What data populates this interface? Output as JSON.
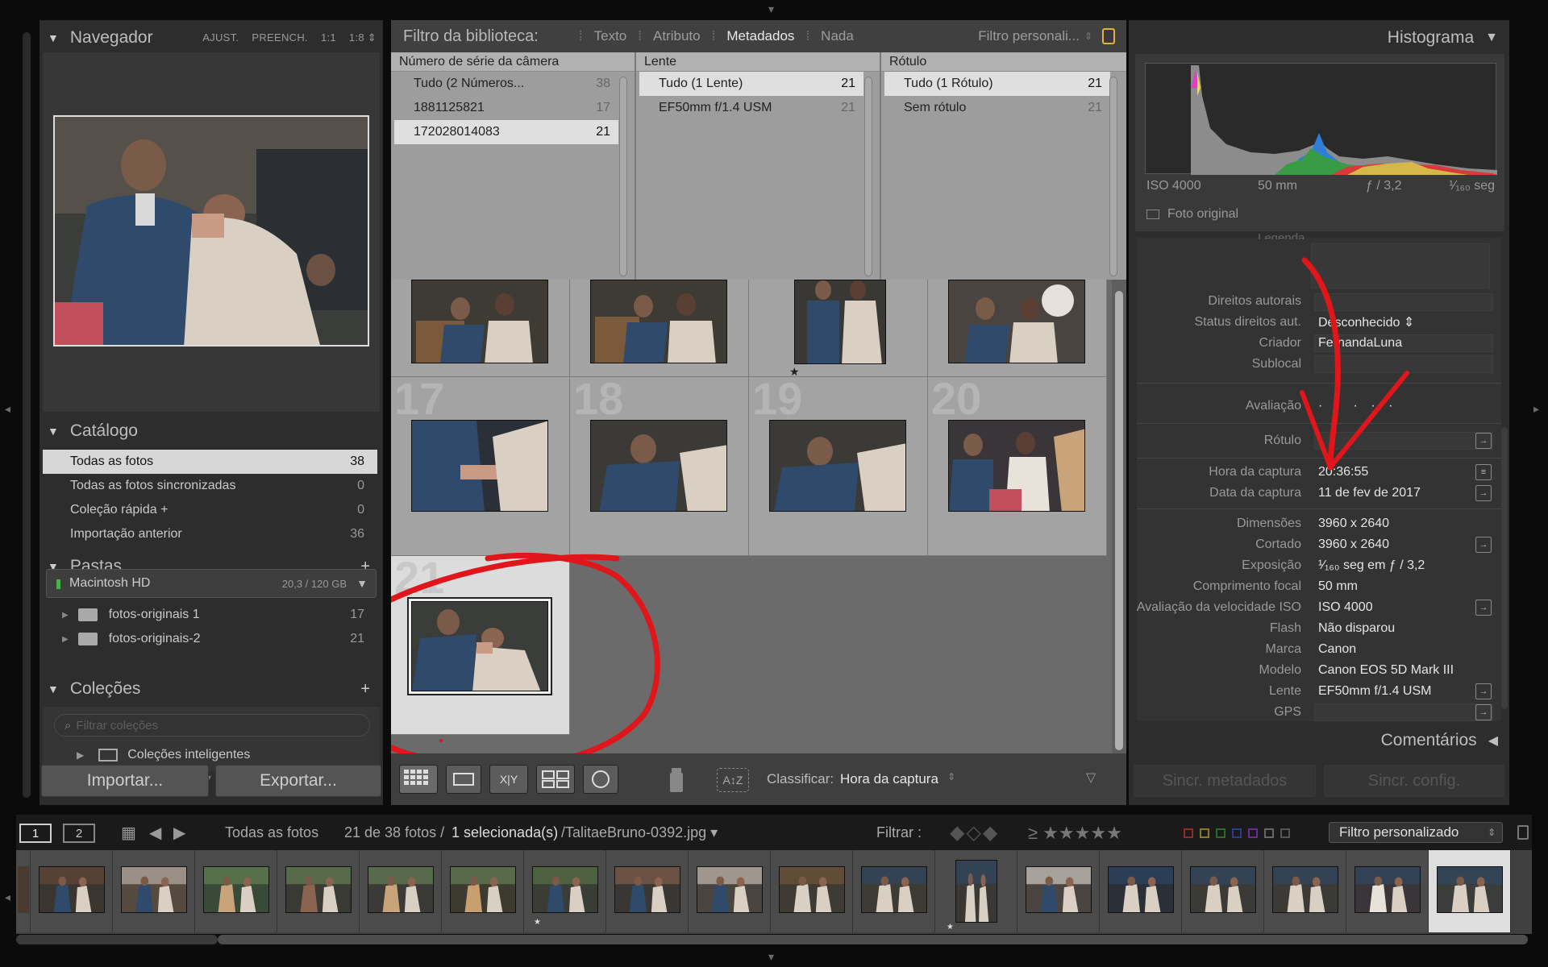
{
  "navigator": {
    "title": "Navegador",
    "opts": [
      "AJUST.",
      "PREENCH.",
      "1:1",
      "1:8 ⇕"
    ]
  },
  "catalog": {
    "title": "Catálogo",
    "items": [
      {
        "label": "Todas as fotos",
        "count": "38"
      },
      {
        "label": "Todas as fotos sincronizadas",
        "count": "0"
      },
      {
        "label": "Coleção rápida +",
        "count": "0"
      },
      {
        "label": "Importação anterior",
        "count": "36"
      }
    ]
  },
  "folders": {
    "title": "Pastas",
    "drive": "Macintosh HD",
    "drive_size": "20,3 / 120 GB",
    "items": [
      {
        "label": "fotos-originais 1",
        "count": "17"
      },
      {
        "label": "fotos-originais-2",
        "count": "21"
      }
    ]
  },
  "collections": {
    "title": "Coleções",
    "filter_placeholder": "Filtrar coleções",
    "smart": "Coleções inteligentes"
  },
  "left_buttons": {
    "import": "Importar...",
    "export": "Exportar..."
  },
  "filter": {
    "title": "Filtro da biblioteca:",
    "tabs": [
      "Texto",
      "Atributo",
      "Metadados",
      "Nada"
    ],
    "active_tab": "Metadados",
    "custom": "Filtro personali...",
    "columns": [
      {
        "header": "Número de série da câmera",
        "rows": [
          {
            "label": "Tudo (2 Números...",
            "count": "38"
          },
          {
            "label": "1881125821",
            "count": "17"
          },
          {
            "label": "172028014083",
            "count": "21",
            "selected": true
          }
        ]
      },
      {
        "header": "Lente",
        "rows": [
          {
            "label": "Tudo (1 Lente)",
            "count": "21",
            "selected": true
          },
          {
            "label": "EF50mm f/1.4 USM",
            "count": "21"
          }
        ]
      },
      {
        "header": "Rótulo",
        "rows": [
          {
            "label": "Tudo (1 Rótulo)",
            "count": "21",
            "selected": true
          },
          {
            "label": "Sem rótulo",
            "count": "21"
          }
        ]
      }
    ]
  },
  "grid": {
    "row2_numbers": [
      "17",
      "18",
      "19",
      "20"
    ],
    "row3_number": "21",
    "star": "★"
  },
  "toolbar": {
    "sort_label": "Classificar:",
    "sort_value": "Hora da captura"
  },
  "histogram": {
    "title": "Histograma",
    "iso": "ISO 4000",
    "focal": "50 mm",
    "aperture": "ƒ / 3,2",
    "shutter": "¹⁄₁₆₀ seg",
    "original": "Foto original"
  },
  "metadata": {
    "caption_label": "Legenda",
    "rows": [
      {
        "label": "Direitos autorais",
        "value": ""
      },
      {
        "label": "Status direitos aut.",
        "value": "Desconhecido ⇕"
      },
      {
        "label": "Criador",
        "value": "FernandaLuna"
      },
      {
        "label": "Sublocal",
        "value": ""
      },
      {
        "label": "Avaliação",
        "value": "· · · · ·"
      },
      {
        "label": "Rótulo",
        "value": ""
      },
      {
        "label": "Hora da captura",
        "value": "20:36:55"
      },
      {
        "label": "Data da captura",
        "value": "11 de fev de 2017"
      },
      {
        "label": "Dimensões",
        "value": "3960 x 2640"
      },
      {
        "label": "Cortado",
        "value": "3960 x 2640"
      },
      {
        "label": "Exposição",
        "value": "¹⁄₁₆₀ seg em ƒ / 3,2"
      },
      {
        "label": "Comprimento focal",
        "value": "50 mm"
      },
      {
        "label": "Avaliação da velocidade ISO",
        "value": "ISO 4000"
      },
      {
        "label": "Flash",
        "value": "Não disparou"
      },
      {
        "label": "Marca",
        "value": "Canon"
      },
      {
        "label": "Modelo",
        "value": "Canon EOS 5D Mark III"
      },
      {
        "label": "Lente",
        "value": "EF50mm f/1.4 USM"
      },
      {
        "label": "GPS",
        "value": ""
      }
    ]
  },
  "comments": {
    "title": "Comentários"
  },
  "right_buttons": {
    "sync_meta": "Sincr. metadados",
    "sync_settings": "Sincr. config."
  },
  "filmbar": {
    "tab1": "1",
    "tab2": "2",
    "source": "Todas as fotos",
    "count_text": "21 de 38 fotos /",
    "selected_text": "1 selecionada(s)",
    "file": "/TalitaeBruno-0392.jpg ▾",
    "filter_label": "Filtrar :",
    "rating_op": "≥ ★★★★★",
    "filter_value": "Filtro personalizado"
  },
  "colors": {
    "panel": "#2d2d2d",
    "grid_bg": "#6b6b6b",
    "cell": "#a3a3a3",
    "annotation": "#e0161b"
  }
}
